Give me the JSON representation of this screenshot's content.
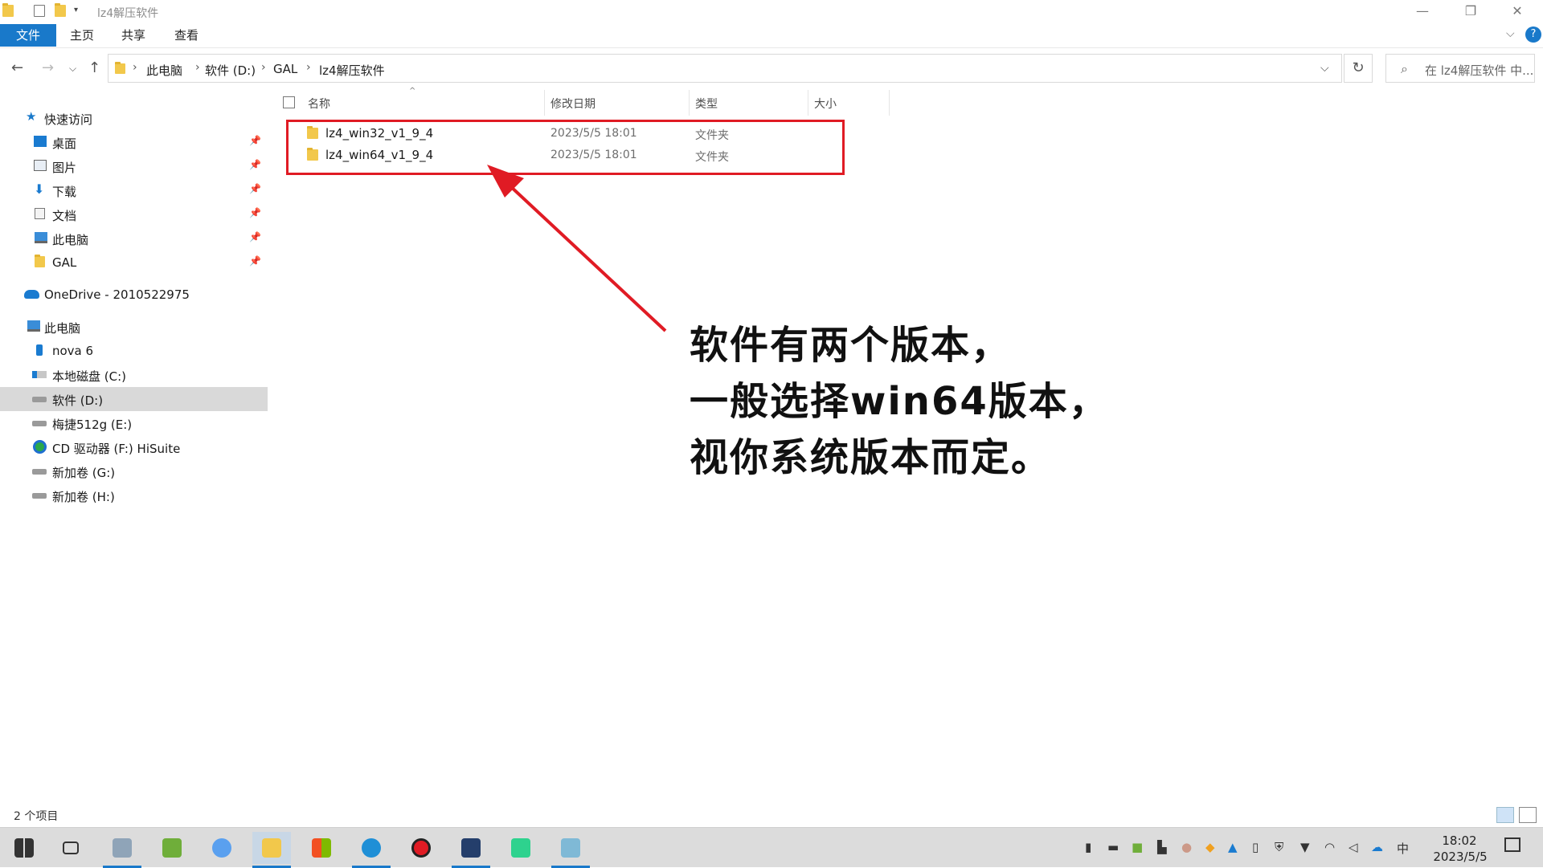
{
  "window": {
    "title": "lz4解压软件",
    "minimize_glyph": "—",
    "restore_glyph": "❐",
    "close_glyph": "✕"
  },
  "ribbon": {
    "tabs": [
      "文件",
      "主页",
      "共享",
      "查看"
    ]
  },
  "address": {
    "breadcrumbs": [
      "此电脑",
      "软件 (D:)",
      "GAL",
      "lz4解压软件"
    ],
    "search_placeholder": "在 lz4解压软件 中..."
  },
  "sidebar": {
    "quick_access": "快速访问",
    "quick_items": [
      "桌面",
      "图片",
      "下载",
      "文档",
      "此电脑",
      "GAL"
    ],
    "onedrive": "OneDrive - 2010522975",
    "this_pc": "此电脑",
    "drives": [
      "nova 6",
      "本地磁盘 (C:)",
      "软件 (D:)",
      "梅捷512g (E:)",
      "CD 驱动器 (F:) HiSuite",
      "新加卷 (G:)",
      "新加卷 (H:)"
    ]
  },
  "filelist": {
    "columns": [
      "名称",
      "修改日期",
      "类型",
      "大小"
    ],
    "rows": [
      {
        "name": "lz4_win32_v1_9_4",
        "date": "2023/5/5 18:01",
        "type": "文件夹"
      },
      {
        "name": "lz4_win64_v1_9_4",
        "date": "2023/5/5 18:01",
        "type": "文件夹"
      }
    ]
  },
  "annotation": {
    "line1": "软件有两个版本，",
    "line2": "一般选择win64版本，",
    "line3": "视你系统版本而定。"
  },
  "status": {
    "count": "2 个项目"
  },
  "taskbar": {
    "time": "18:02",
    "date": "2023/5/5",
    "ime": "中"
  },
  "colors": {
    "accent": "#1979ca",
    "highlight_red": "#e01b24",
    "folder_yellow": "#f2c84b"
  }
}
